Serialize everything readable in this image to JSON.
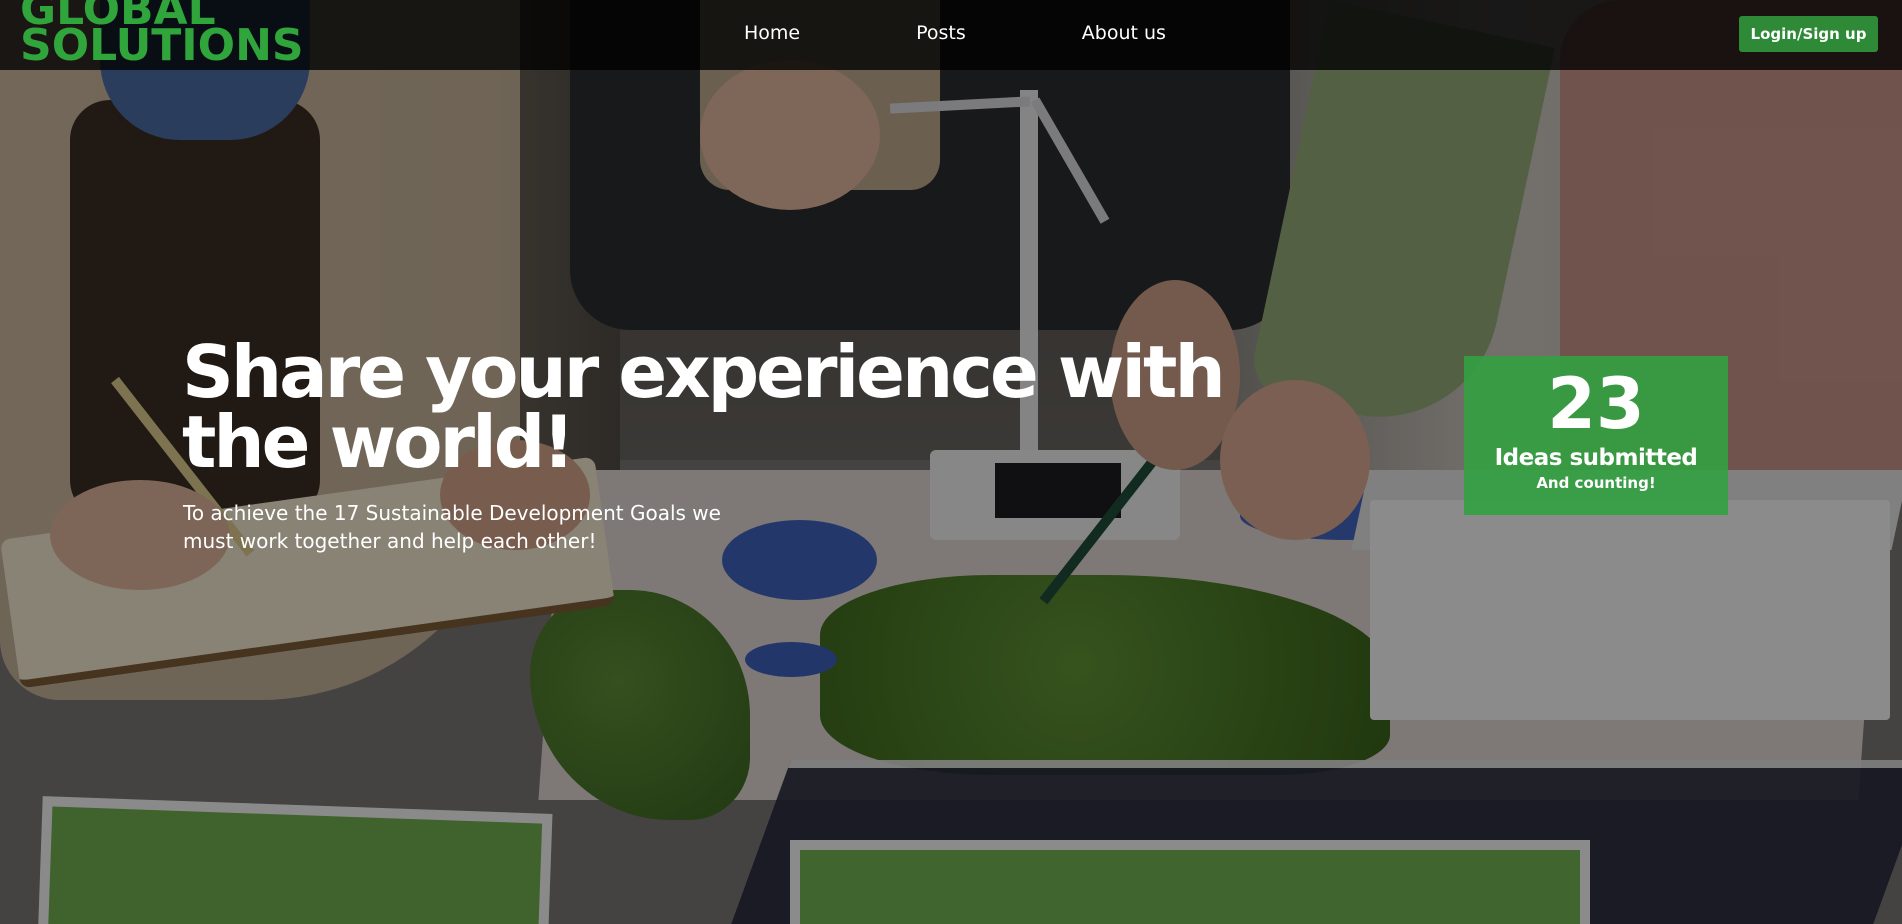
{
  "brand": {
    "logo_line1": "GLOBAL",
    "logo_line2": "SOLUTIONS",
    "color": "#2fa53c"
  },
  "nav": {
    "items": [
      {
        "label": "Home"
      },
      {
        "label": "Posts"
      },
      {
        "label": "About us"
      }
    ],
    "login_label": "Login/Sign up",
    "login_color": "#2f8a37"
  },
  "hero": {
    "title": "Share your experience with the world!",
    "subtitle": "To achieve the 17 Sustainable Development Goals we must work together and help each other!",
    "background_image": "photo-team-sustainability-model"
  },
  "stats": {
    "count": "23",
    "label": "Ideas submitted",
    "sublabel": "And counting!",
    "color": "#34a042"
  }
}
